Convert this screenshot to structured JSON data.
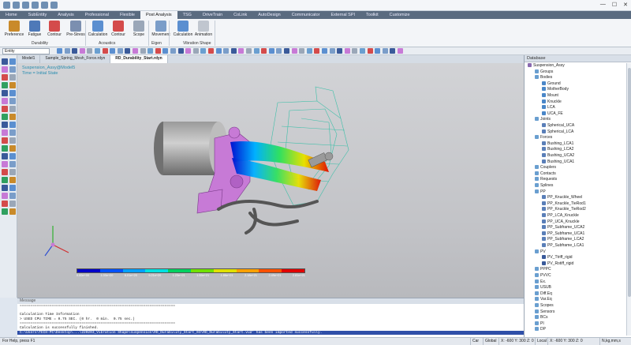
{
  "window": {
    "minimize": "—",
    "maximize": "☐",
    "close": "✕"
  },
  "tabs": [
    "Home",
    "SubEntity",
    "Analysis",
    "Professional",
    "Flexible",
    "Post Analysis",
    "TSG",
    "DriveTrain",
    "CoLink",
    "AutoDesign",
    "Communicator",
    "External SPI",
    "Toolkit",
    "Customize"
  ],
  "active_tab": "Post Analysis",
  "ribbon": {
    "buttons": [
      {
        "label": "Preference",
        "icon": "wrench-icon",
        "color": "#c98a2a"
      },
      {
        "label": "Fatigue",
        "icon": "fatigue-icon",
        "color": "#4e79b8"
      },
      {
        "label": "Contour",
        "icon": "contour-icon",
        "color": "#d44b4b"
      },
      {
        "label": "Pre-Stress",
        "icon": "prestress-icon",
        "color": "#7b8fb0"
      },
      {
        "label": "Calculation",
        "icon": "gear-icon",
        "color": "#5b8fd0"
      },
      {
        "label": "Contour",
        "icon": "contour-icon",
        "color": "#d44b4b"
      },
      {
        "label": "Scope",
        "icon": "scope-icon",
        "color": "#9aa7b8"
      },
      {
        "label": "Movement",
        "icon": "movement-icon",
        "color": "#7a9dc9"
      },
      {
        "label": "Calculation",
        "icon": "gear-icon",
        "color": "#5b8fd0"
      },
      {
        "label": "Animation",
        "icon": "animation-icon",
        "color": "#c0c6cf"
      }
    ],
    "groups": [
      "Durability",
      "Acoustics",
      "Eigen",
      "Vibration Shape"
    ]
  },
  "entity_select": "Entity",
  "doc_tabs": [
    "Model1",
    "Sample_Spring_Mesh_Force.rdyn",
    "RD_Durability_Start.rdyn"
  ],
  "active_doc": "RD_Durability_Start.rdyn",
  "viewport": {
    "line1": "Suspension_Assy@Model5",
    "line2": "Time = Initial State"
  },
  "legend": {
    "colors": [
      "#0000c8",
      "#0050ff",
      "#00a0ff",
      "#00e0e0",
      "#00d060",
      "#70e000",
      "#e0e000",
      "#ffa000",
      "#ff5000",
      "#e00000"
    ],
    "ticks": [
      "0.00e+00",
      "1.00e+20",
      "6.01e+20",
      "9.21e+20",
      "1.23e+21",
      "1.55e+21",
      "1.86e+21",
      "2.18e+21",
      "2.49e+21",
      "2.81e+21"
    ]
  },
  "database": {
    "header": "Database",
    "items": [
      {
        "label": "Suspension_Assy",
        "level": 0,
        "color": "#8a6ab0"
      },
      {
        "label": "Groups",
        "level": 1,
        "color": "#6a9fd0"
      },
      {
        "label": "Bodies",
        "level": 1,
        "color": "#6a9fd0"
      },
      {
        "label": "Ground",
        "level": 2,
        "color": "#4a87c8"
      },
      {
        "label": "MotherBody",
        "level": 2,
        "color": "#4a87c8"
      },
      {
        "label": "Mount",
        "level": 2,
        "color": "#4a87c8"
      },
      {
        "label": "Knuckle",
        "level": 2,
        "color": "#4a87c8"
      },
      {
        "label": "LCA",
        "level": 2,
        "color": "#4a87c8"
      },
      {
        "label": "UCA_FE",
        "level": 2,
        "color": "#4a87c8"
      },
      {
        "label": "Joints",
        "level": 1,
        "color": "#6a9fd0"
      },
      {
        "label": "Spherical_UCA",
        "level": 2,
        "color": "#5a7fb8"
      },
      {
        "label": "Spherical_LCA",
        "level": 2,
        "color": "#5a7fb8"
      },
      {
        "label": "Forces",
        "level": 1,
        "color": "#6a9fd0"
      },
      {
        "label": "Bushing_LCA1",
        "level": 2,
        "color": "#5a7fb8"
      },
      {
        "label": "Bushing_LCA2",
        "level": 2,
        "color": "#5a7fb8"
      },
      {
        "label": "Bushing_UCA2",
        "level": 2,
        "color": "#5a7fb8"
      },
      {
        "label": "Bushing_UCA1",
        "level": 2,
        "color": "#5a7fb8"
      },
      {
        "label": "Couplers",
        "level": 1,
        "color": "#6a9fd0"
      },
      {
        "label": "Contacts",
        "level": 1,
        "color": "#6a9fd0"
      },
      {
        "label": "Requests",
        "level": 1,
        "color": "#6a9fd0"
      },
      {
        "label": "Splines",
        "level": 1,
        "color": "#6a9fd0"
      },
      {
        "label": "PP",
        "level": 1,
        "color": "#6a9fd0"
      },
      {
        "label": "PP_Knuckle_Wheel",
        "level": 2,
        "color": "#5a7fb8"
      },
      {
        "label": "PP_Knuckle_TieRod1",
        "level": 2,
        "color": "#5a7fb8"
      },
      {
        "label": "PP_Knuckle_TieRod2",
        "level": 2,
        "color": "#5a7fb8"
      },
      {
        "label": "PP_LCA_Knuckle",
        "level": 2,
        "color": "#5a7fb8"
      },
      {
        "label": "PP_UCA_Knuckle",
        "level": 2,
        "color": "#5a7fb8"
      },
      {
        "label": "PP_Subframe_UCA2",
        "level": 2,
        "color": "#5a7fb8"
      },
      {
        "label": "PP_Subframe_UCA1",
        "level": 2,
        "color": "#5a7fb8"
      },
      {
        "label": "PP_Subframe_LCA2",
        "level": 2,
        "color": "#5a7fb8"
      },
      {
        "label": "PP_Subframe_LCA1",
        "level": 2,
        "color": "#5a7fb8"
      },
      {
        "label": "PV",
        "level": 1,
        "color": "#6a9fd0"
      },
      {
        "label": "PV_Ttriff_rigid",
        "level": 2,
        "color": "#3a5a9a"
      },
      {
        "label": "PV_Rotiff_rigid",
        "level": 2,
        "color": "#3a5a9a"
      },
      {
        "label": "PPPC",
        "level": 1,
        "color": "#6a9fd0"
      },
      {
        "label": "PVVC",
        "level": 1,
        "color": "#6a9fd0"
      },
      {
        "label": "Ex.",
        "level": 1,
        "color": "#6a9fd0"
      },
      {
        "label": "USUB",
        "level": 1,
        "color": "#6a9fd0"
      },
      {
        "label": "Diff.Eq",
        "level": 1,
        "color": "#6a9fd0"
      },
      {
        "label": "Var.Eq",
        "level": 1,
        "color": "#6a9fd0"
      },
      {
        "label": "Scopes",
        "level": 1,
        "color": "#6a9fd0"
      },
      {
        "label": "Sensors",
        "level": 1,
        "color": "#6a9fd0"
      },
      {
        "label": "BCs",
        "level": 1,
        "color": "#6a9fd0"
      },
      {
        "label": "PI",
        "level": 1,
        "color": "#6a9fd0"
      },
      {
        "label": "DP",
        "level": 1,
        "color": "#6a9fd0"
      }
    ]
  },
  "message": {
    "header": "Message",
    "lines": [
      "=========================================================================",
      "",
      "Calculation Time Information",
      "> USED CPU TIME = 0.75 SEC. (0 hr.  0 min.  0.75 sec.)",
      "=========================================================================",
      "Calculation is successfully finished."
    ],
    "last_line": "C:\\Users\\TECH-PC\\Desktop\\...\\220203_Vibration Shape\\suspension\\RD_Durability_Start_03\\RD_Durability_Start.vud' has been imported successfully."
  },
  "status": {
    "left": "For Help, press F1",
    "cells": [
      "Car",
      "Global",
      "X: -600 Y: 300 Z: 0",
      "Local",
      "X: -600 Y: 300 Z: 0",
      "N,kg,mm,s"
    ]
  }
}
